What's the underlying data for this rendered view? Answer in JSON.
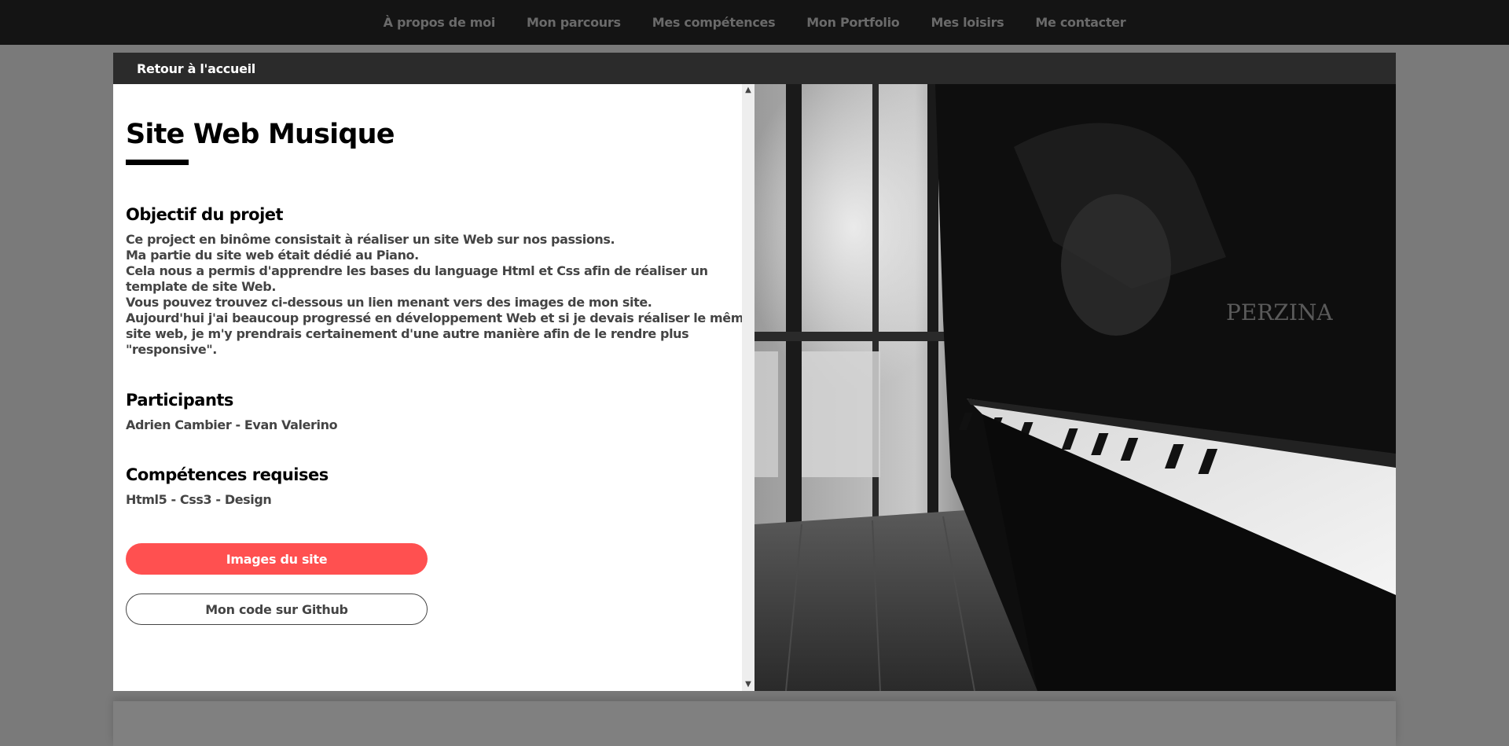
{
  "nav": {
    "items": [
      "À propos de moi",
      "Mon parcours",
      "Mes compétences",
      "Mon Portfolio",
      "Mes loisirs",
      "Me contacter"
    ]
  },
  "modal": {
    "back_label": "Retour à l'accueil",
    "title": "Site Web Musique",
    "objective": {
      "heading": "Objectif du projet",
      "lines": [
        "Ce project en binôme consistait à réaliser un site Web sur nos passions.",
        "Ma partie du site web était dédié au Piano.",
        "Cela nous a permis d'apprendre les bases du language Html et Css afin de réaliser un",
        "template de site Web.",
        "Vous pouvez trouvez ci-dessous un lien menant vers des images de mon site.",
        "Aujourd'hui j'ai beaucoup progressé en développement Web et si je devais réaliser le même",
        "site web, je m'y prendrais certainement d'une autre manière afin de le rendre plus",
        "\"responsive\"."
      ]
    },
    "participants": {
      "heading": "Participants",
      "value": "Adrien Cambier - Evan Valerino"
    },
    "skills": {
      "heading": "Compétences requises",
      "value": "Html5 - Css3 - Design"
    },
    "buttons": {
      "images_label": "Images du site",
      "github_label": "Mon code sur Github"
    },
    "photo": {
      "brand_text": "PERZINA"
    }
  },
  "colors": {
    "accent": "#ff5050",
    "nav_bg": "#141414",
    "modal_header_bg": "#2b2b2b",
    "overlay": "#7a7a7a"
  }
}
